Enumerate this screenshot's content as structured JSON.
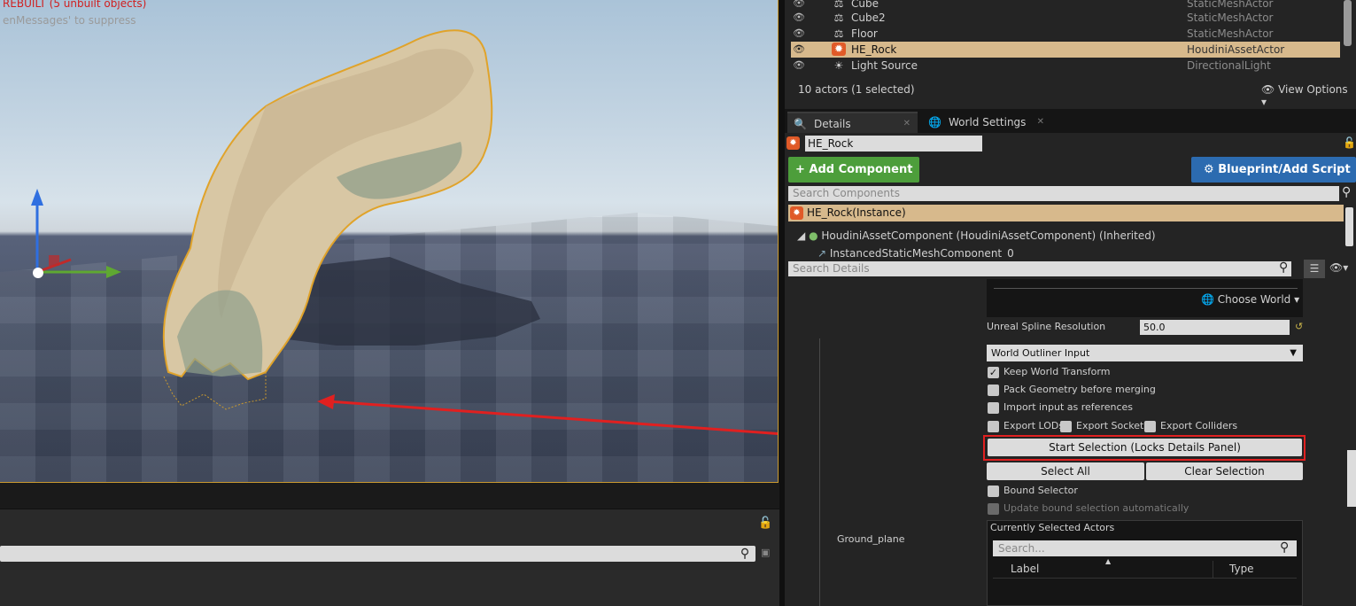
{
  "viewport": {
    "warning_line1": "REBUILT (5 unbuilt objects)",
    "warning_line2": "enMessages' to suppress"
  },
  "outliner": {
    "rows": [
      {
        "name": "Cube",
        "type": "StaticMeshActor",
        "icon": "static-mesh-icon",
        "selected": false
      },
      {
        "name": "Cube2",
        "type": "StaticMeshActor",
        "icon": "static-mesh-icon",
        "selected": false
      },
      {
        "name": "Floor",
        "type": "StaticMeshActor",
        "icon": "static-mesh-icon",
        "selected": false
      },
      {
        "name": "HE_Rock",
        "type": "HoudiniAssetActor",
        "icon": "houdini-icon",
        "selected": true
      },
      {
        "name": "Light Source",
        "type": "DirectionalLight",
        "icon": "light-icon",
        "selected": false
      }
    ],
    "actor_count": "10 actors (1 selected)",
    "view_options": "View Options"
  },
  "tabs": {
    "details": "Details",
    "world_settings": "World Settings"
  },
  "details": {
    "actor_name": "HE_Rock",
    "add_component": "Add Component",
    "blueprint": "Blueprint/Add Script",
    "search_components_placeholder": "Search Components",
    "component_instance": "HE_Rock(Instance)",
    "component_houdini": "HoudiniAssetComponent (HoudiniAssetComponent) (Inherited)",
    "component_ism": "InstancedStaticMeshComponent_0",
    "search_details_placeholder": "Search Details",
    "choose_world": "Choose World",
    "spline_label": "Unreal Spline Resolution",
    "spline_value": "50.0",
    "input_type": "World Outliner Input",
    "keep_world_transform": "Keep World Transform",
    "pack_geometry": "Pack Geometry before merging",
    "import_as_refs": "Import input as references",
    "export_lods": "Export LODs",
    "export_sockets": "Export Sockets",
    "export_colliders": "Export Colliders",
    "start_selection": "Start Selection (Locks Details Panel)",
    "select_all": "Select All",
    "clear_selection": "Clear Selection",
    "bound_selector": "Bound Selector",
    "update_bound": "Update bound selection automatically",
    "ground_plane": "Ground_plane",
    "currently_selected": "Currently Selected Actors",
    "search_placeholder": "Search...",
    "col_label": "Label",
    "col_type": "Type"
  },
  "colors": {
    "selection": "#d7b98c",
    "add_component": "#4d9e3b",
    "blueprint": "#2c6bb0",
    "highlight_box": "#e02020",
    "viewport_border": "#c9992f"
  }
}
